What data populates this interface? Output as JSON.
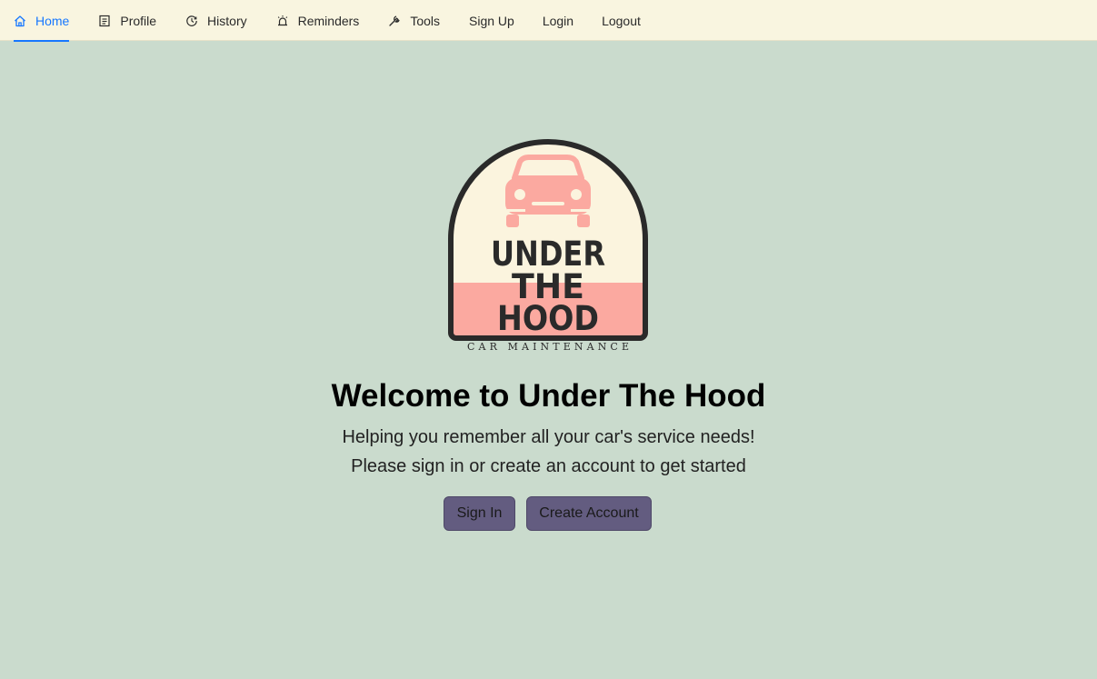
{
  "nav": {
    "items": [
      {
        "label": "Home",
        "icon": "home-icon",
        "active": true
      },
      {
        "label": "Profile",
        "icon": "profile-icon"
      },
      {
        "label": "History",
        "icon": "history-icon"
      },
      {
        "label": "Reminders",
        "icon": "alarm-icon"
      },
      {
        "label": "Tools",
        "icon": "wrench-icon"
      },
      {
        "label": "Sign Up"
      },
      {
        "label": "Login"
      },
      {
        "label": "Logout"
      }
    ],
    "active_color": "#1677ff"
  },
  "logo": {
    "line1": "UNDER",
    "line2": "THE",
    "line3": "HOOD",
    "tagline": "CAR MAINTENANCE",
    "colors": {
      "cream": "#fbf4de",
      "pink": "#fba9a0",
      "outline": "#2a2a2a"
    }
  },
  "main": {
    "title": "Welcome to Under The Hood",
    "subtitle1": "Helping you remember all your car's service needs!",
    "subtitle2": "Please sign in or create an account to get started",
    "signin_label": "Sign In",
    "create_label": "Create Account",
    "button_color": "#635c80",
    "background": "#cadbcd"
  }
}
